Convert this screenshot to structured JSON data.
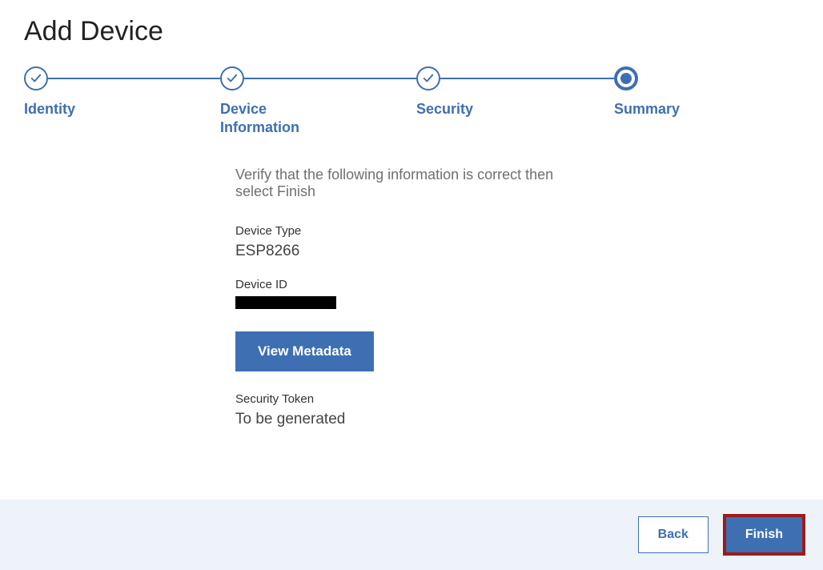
{
  "page": {
    "title": "Add Device",
    "instruction": "Verify that the following information is correct then select Finish"
  },
  "stepper": {
    "steps": [
      {
        "label": "Identity",
        "state": "complete"
      },
      {
        "label": "Device Information",
        "state": "complete"
      },
      {
        "label": "Security",
        "state": "complete"
      },
      {
        "label": "Summary",
        "state": "current"
      }
    ]
  },
  "summary": {
    "device_type_label": "Device Type",
    "device_type_value": "ESP8266",
    "device_id_label": "Device ID",
    "device_id_value": "[redacted]",
    "view_metadata_label": "View Metadata",
    "security_token_label": "Security Token",
    "security_token_value": "To be generated"
  },
  "footer": {
    "back_label": "Back",
    "finish_label": "Finish"
  },
  "colors": {
    "accent": "#3e6fb3",
    "highlight_border": "#9e1b1b",
    "footer_bg": "#eef3f9"
  }
}
